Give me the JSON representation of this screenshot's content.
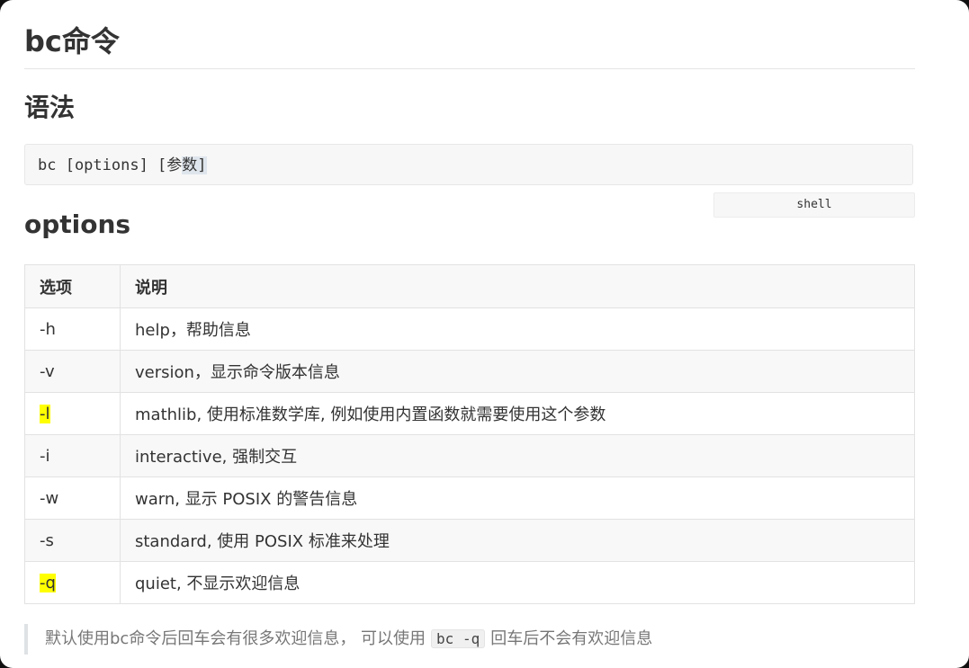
{
  "title": "bc命令",
  "syntax_heading": "语法",
  "code": {
    "prefix": "bc [options] [参",
    "highlighted": "数]",
    "language": "shell"
  },
  "options_heading": "options",
  "table": {
    "headers": [
      "选项",
      "说明"
    ],
    "rows": [
      {
        "option": "-h",
        "desc": "help，帮助信息",
        "marked": false
      },
      {
        "option": "-v",
        "desc": "version，显示命令版本信息",
        "marked": false
      },
      {
        "option": "-l",
        "desc": "mathlib, 使用标准数学库, 例如使用内置函数就需要使用这个参数",
        "marked": true
      },
      {
        "option": "-i",
        "desc": "interactive, 强制交互",
        "marked": false
      },
      {
        "option": "-w",
        "desc": "warn, 显示 POSIX 的警告信息",
        "marked": false
      },
      {
        "option": "-s",
        "desc": "standard, 使用 POSIX 标准来处理",
        "marked": false
      },
      {
        "option": "-q",
        "desc": "quiet, 不显示欢迎信息",
        "marked": true
      }
    ]
  },
  "note": {
    "before": "默认使用bc命令后回车会有很多欢迎信息， 可以使用",
    "code": "bc -q",
    "after": "回车后不会有欢迎信息"
  },
  "colors": {
    "highlight": "#ffff00",
    "text": "#333333",
    "quote_text": "#777777"
  }
}
